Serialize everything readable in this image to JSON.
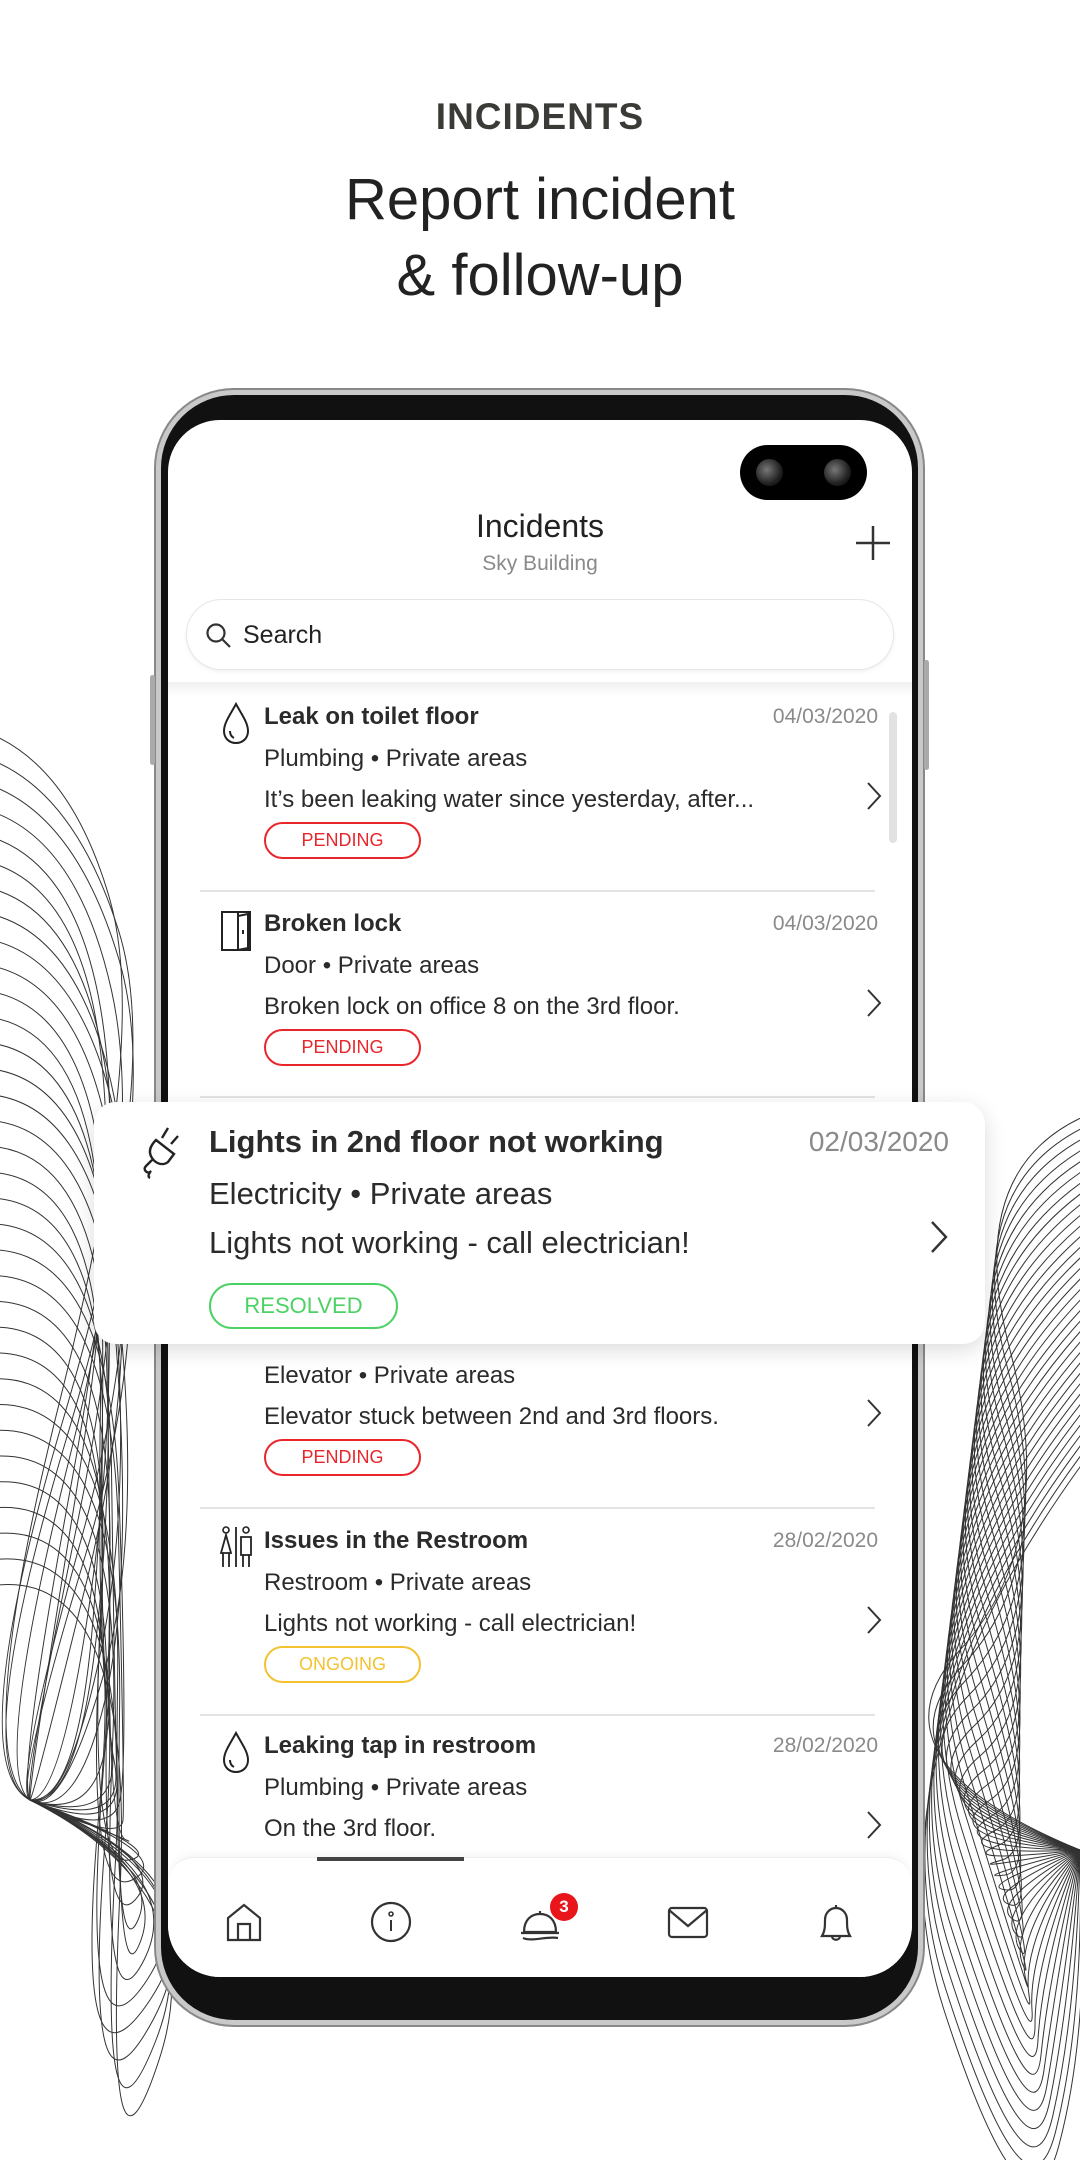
{
  "promo": {
    "kicker": "INCIDENTS",
    "headline_line1": "Report incident",
    "headline_line2": "& follow-up"
  },
  "header": {
    "title": "Incidents",
    "subtitle": "Sky Building",
    "add_icon": "plus-icon"
  },
  "search": {
    "placeholder": "Search",
    "value": ""
  },
  "colors": {
    "pending": "#e8262c",
    "resolved": "#4cd164",
    "ongoing": "#f2c230",
    "badge": "#e8151b"
  },
  "incidents": [
    {
      "icon": "water-drop-icon",
      "title": "Leak on toilet floor",
      "date": "04/03/2020",
      "meta": "Plumbing • Private areas",
      "description": "It’s been leaking water since yesterday, after...",
      "status": "PENDING"
    },
    {
      "icon": "door-icon",
      "title": "Broken lock",
      "date": "04/03/2020",
      "meta": "Door • Private areas",
      "description": "Broken lock on office 8 on the 3rd floor.",
      "status": "PENDING"
    },
    {
      "icon": "elevator-icon",
      "meta": "Elevator • Private areas",
      "description": "Elevator stuck between 2nd and 3rd floors.",
      "status": "PENDING"
    },
    {
      "icon": "restroom-icon",
      "title": "Issues in the Restroom",
      "date": "28/02/2020",
      "meta": "Restroom • Private areas",
      "description": "Lights not working - call electrician!",
      "status": "ONGOING"
    },
    {
      "icon": "water-drop-icon",
      "title": "Leaking tap in restroom",
      "date": "28/02/2020",
      "meta": "Plumbing • Private areas",
      "description": "On the 3rd floor."
    }
  ],
  "highlight": {
    "icon": "plug-icon",
    "title": "Lights in 2nd floor not working",
    "date": "02/03/2020",
    "meta": "Electricity • Private areas",
    "description": "Lights not working - call electrician!",
    "status": "RESOLVED"
  },
  "nav": {
    "items": [
      "home-icon",
      "info-icon",
      "incidents-bell-icon",
      "mail-icon",
      "notifications-icon"
    ],
    "active": 2,
    "incidents_badge": "3"
  }
}
